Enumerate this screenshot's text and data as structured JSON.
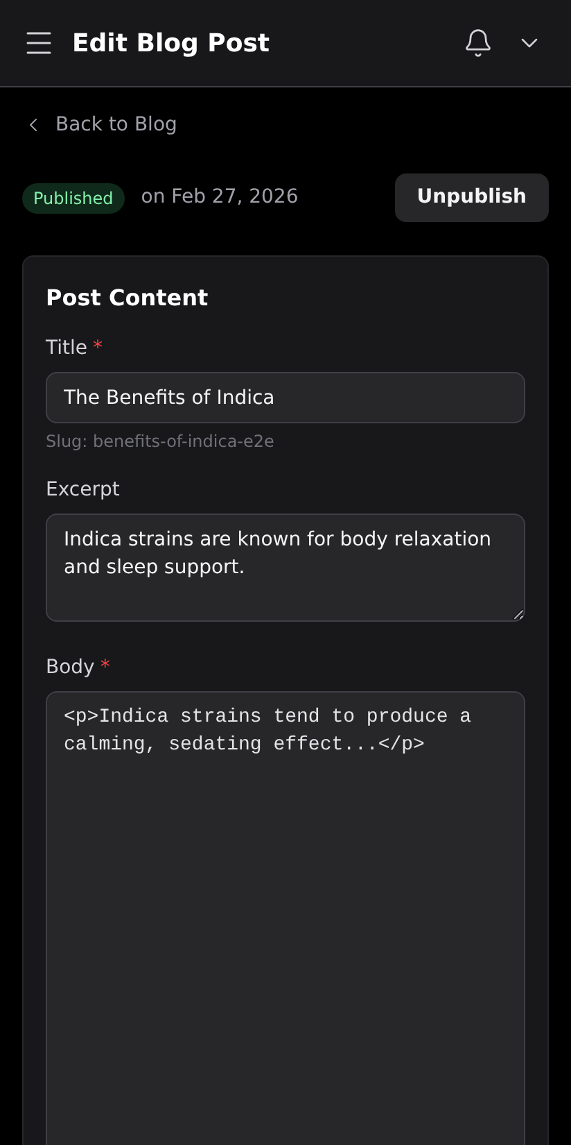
{
  "header": {
    "title": "Edit Blog Post"
  },
  "back_link": {
    "label": "Back to Blog"
  },
  "status": {
    "badge": "Published",
    "date": "on Feb 27, 2026",
    "action": "Unpublish"
  },
  "card": {
    "title": "Post Content",
    "fields": [
      {
        "kind": "input",
        "label": "Title",
        "required_mark": "*",
        "value": "The Benefits of Indica",
        "hint": "Slug: benefits-of-indica-e2e"
      },
      {
        "kind": "textarea",
        "label": "Excerpt",
        "value": "Indica strains are known for body relaxation and sleep support."
      },
      {
        "kind": "code",
        "label": "Body",
        "required_mark": "*",
        "value": "<p>Indica strains tend to produce a calming, sedating effect...</p>"
      }
    ]
  }
}
